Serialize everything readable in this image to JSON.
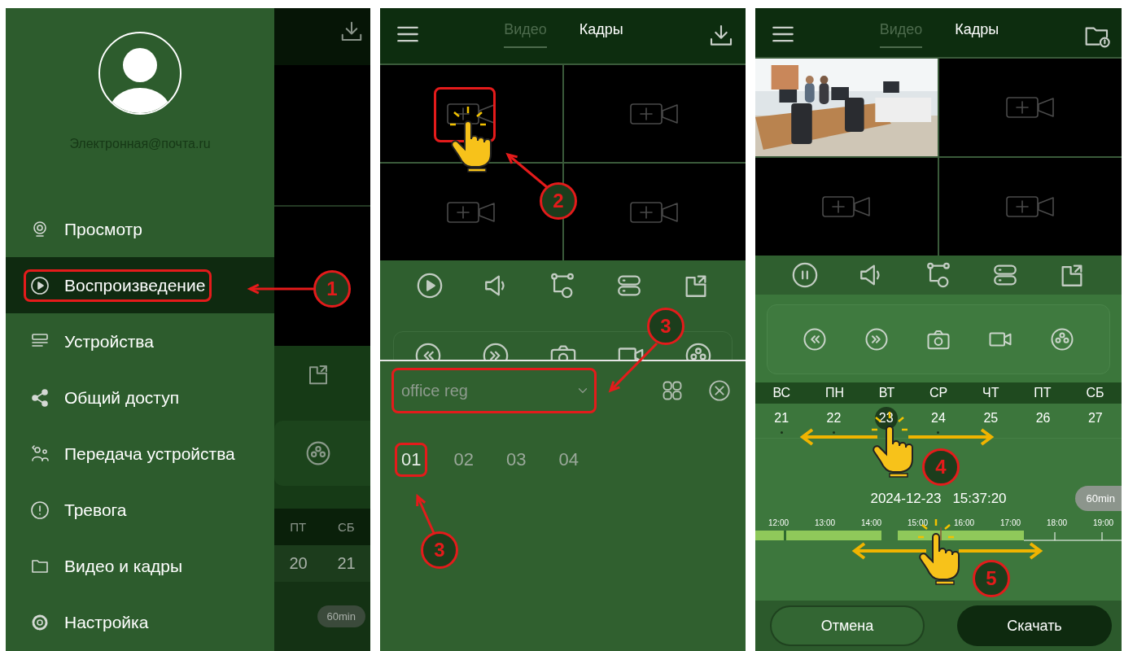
{
  "drawer_screen": {
    "account": {
      "email": "Электронная@почта.ru"
    },
    "menu": [
      {
        "label": "Просмотр",
        "selected": false,
        "marked": false
      },
      {
        "label": "Воспроизведение",
        "selected": true,
        "marked": true
      },
      {
        "label": "Устройства",
        "selected": false,
        "marked": false
      },
      {
        "label": "Общий доступ",
        "selected": false,
        "marked": false
      },
      {
        "label": "Передача устройства",
        "selected": false,
        "marked": false
      },
      {
        "label": "Тревога",
        "selected": false,
        "marked": false
      },
      {
        "label": "Видео и кадры",
        "selected": false,
        "marked": false
      },
      {
        "label": "Настройка",
        "selected": false,
        "marked": false
      }
    ],
    "behind": {
      "weekdays": [
        "ПТ",
        "СБ"
      ],
      "dates": [
        "20",
        "21"
      ],
      "zoom": "60min"
    },
    "callouts": [
      {
        "number": "1"
      }
    ]
  },
  "camera_screen": {
    "tabs": [
      {
        "label": "Видео",
        "selected": true
      },
      {
        "label": "Кадры",
        "selected": false
      }
    ],
    "cells": [
      {
        "marked": true
      },
      {
        "marked": false
      },
      {
        "marked": false
      },
      {
        "marked": false
      }
    ],
    "device_select": {
      "value": "office reg",
      "marked": true
    },
    "channels": [
      {
        "label": "01",
        "selected": true,
        "marked": true
      },
      {
        "label": "02",
        "selected": false,
        "marked": false
      },
      {
        "label": "03",
        "selected": false,
        "marked": false
      },
      {
        "label": "04",
        "selected": false,
        "marked": false
      }
    ],
    "callouts": [
      {
        "number": "2"
      },
      {
        "number": "3"
      },
      {
        "number": "3"
      }
    ]
  },
  "playback_screen": {
    "tabs": [
      {
        "label": "Видео",
        "selected": true
      },
      {
        "label": "Кадры",
        "selected": false
      }
    ],
    "cells": [
      {
        "kind": "picture"
      },
      {
        "kind": "empty"
      },
      {
        "kind": "empty"
      },
      {
        "kind": "empty"
      }
    ],
    "weekdays": [
      "ВС",
      "ПН",
      "ВТ",
      "СР",
      "ЧТ",
      "ПТ",
      "СБ"
    ],
    "dates": [
      {
        "label": "21",
        "selected": false,
        "has_records": true
      },
      {
        "label": "22",
        "selected": false,
        "has_records": true
      },
      {
        "label": "23",
        "selected": true,
        "has_records": false
      },
      {
        "label": "24",
        "selected": false,
        "has_records": true
      },
      {
        "label": "25",
        "selected": false,
        "has_records": false
      },
      {
        "label": "26",
        "selected": false,
        "has_records": false
      },
      {
        "label": "27",
        "selected": false,
        "has_records": false
      }
    ],
    "date": "2024-12-23",
    "time": "15:37:20",
    "zoom": "60min",
    "timeline_labels": [
      "12:00",
      "13:00",
      "14:00",
      "15:00",
      "16:00",
      "17:00",
      "18:00",
      "19:00"
    ],
    "buttons": [
      {
        "label": "Отмена",
        "kind": "outline"
      },
      {
        "label": "Скачать",
        "kind": "filled"
      }
    ],
    "callouts": [
      {
        "number": "4"
      },
      {
        "number": "5"
      }
    ]
  }
}
